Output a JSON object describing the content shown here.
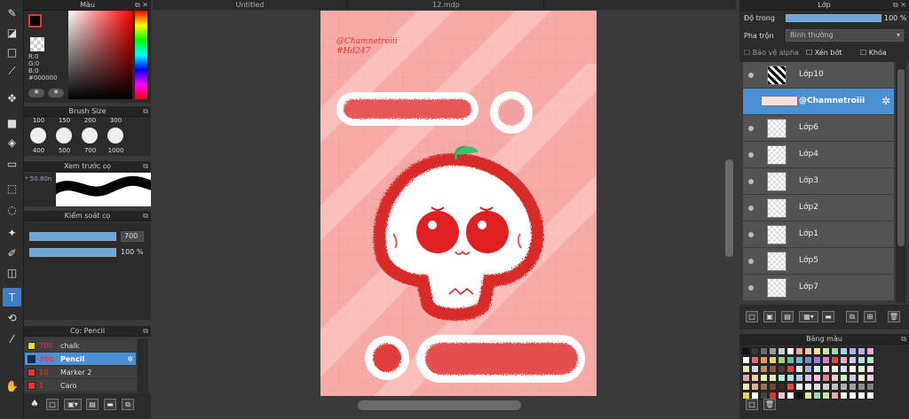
{
  "tools": [
    {
      "icon": "brush-icon"
    },
    {
      "icon": "eraser-icon"
    },
    {
      "icon": "rectangle-icon"
    },
    {
      "icon": "line-icon"
    },
    {
      "icon": "move-icon"
    },
    {
      "icon": "fill-rect-icon"
    },
    {
      "icon": "bucket-icon"
    },
    {
      "icon": "gradient-icon"
    },
    {
      "icon": "select-rect-icon"
    },
    {
      "icon": "lasso-icon"
    },
    {
      "icon": "magic-wand-icon"
    },
    {
      "icon": "select-pen-icon"
    },
    {
      "icon": "select-eraser-icon"
    },
    {
      "icon": "text-icon"
    },
    {
      "icon": "divide-icon"
    },
    {
      "icon": "dropper-icon"
    },
    {
      "icon": "hand-icon"
    }
  ],
  "color_panel": {
    "title": "Màu",
    "r": "R:0",
    "g": "G:0",
    "b": "B:0",
    "hex": "#000000"
  },
  "brush_size": {
    "title": "Brush Size",
    "top_row": [
      "100",
      "150",
      "200",
      "300"
    ],
    "sizes": [
      "400",
      "500",
      "700",
      "1000"
    ]
  },
  "brush_preview": {
    "title": "Xem trước cọ",
    "size_label": "50.80n"
  },
  "brush_control": {
    "title": "Kiểm soát cọ",
    "size_value": "700",
    "opacity_value": "100 %"
  },
  "brush_list": {
    "title": "Cọ: Pencil",
    "items": [
      {
        "size": "700",
        "name": "chalk",
        "color": "#f2d536"
      },
      {
        "size": "700",
        "name": "Pencil",
        "color": "#1f2a44",
        "selected": true
      },
      {
        "size": "10",
        "name": "Marker 2",
        "color": "#e53535"
      },
      {
        "size": "1",
        "name": "Caro",
        "color": "#e53535"
      }
    ]
  },
  "tabs": [
    "Untitled",
    "12.mdp"
  ],
  "canvas": {
    "watermark_line1": "@Chamnetroiii",
    "watermark_line2": "#Hd247"
  },
  "layer_panel": {
    "title": "Lớp",
    "opacity_label": "Độ trong",
    "opacity_value": "100 %",
    "blend_label": "Pha trộn",
    "blend_value": "Bình thường",
    "protect_alpha": "Bảo vệ alpha",
    "clipping": "Xén bớt",
    "lock": "Khóa",
    "layers": [
      {
        "name": "Lớp10"
      },
      {
        "name": "@Chamnetroiii",
        "selected": true
      },
      {
        "name": "Lớp6"
      },
      {
        "name": "Lớp4"
      },
      {
        "name": "Lớp3"
      },
      {
        "name": "Lớp2"
      },
      {
        "name": "Lớp1"
      },
      {
        "name": "Lớp5"
      },
      {
        "name": "Lớp7"
      }
    ]
  },
  "palette": {
    "title": "Bảng màu",
    "colors": [
      "#111111",
      "#3a3a3a",
      "#6b6b6b",
      "#9c9c9c",
      "#cfcfcf",
      "#ffffff",
      "#f4a6a6",
      "#f7c59f",
      "#f8e08e",
      "#c7e99b",
      "#9ed8b8",
      "#9ad6e5",
      "#a3b8ef",
      "#c2a8ef",
      "#eba7de",
      "#ffffff",
      "#e86b6b",
      "#f09a5a",
      "#f3cf4f",
      "#9fd66a",
      "#5fc49a",
      "#5abed8",
      "#6f8de0",
      "#9a78df",
      "#e47ccc",
      "#e84141",
      "#f2a8c8",
      "#c9c9f1",
      "#a8e0f2",
      "#b4efc2",
      "#f1e6a8",
      "#d8d8d8",
      "#c48a58",
      "#8c5a3a",
      "#5a3a2a",
      "#d44",
      "#e2e2e2",
      "#aad",
      "#cfe",
      "#fde",
      "#efd",
      "#ddf",
      "#ffd",
      "#dfd",
      "#fdd",
      "#e9a0a0",
      "#f4d2a0",
      "#f4ecb0",
      "#d8f0b0",
      "#b0f0d8",
      "#b0e0f0",
      "#b8c8f4",
      "#d8c0f4",
      "#f4c0e8",
      "#f08080",
      "#f8c8c8",
      "#c8f8c8",
      "#c8c8f8",
      "#f8f8c8",
      "#f8c8f8",
      "#ffe4b0",
      "#e0b080",
      "#a07050",
      "#704830",
      "#402818",
      "#ff4040",
      "#ffffff",
      "#f0f0f0",
      "#e0e0e0",
      "#d0d0d0",
      "#c0c0c0",
      "#b0b0b0",
      "#a0a0a0",
      "#909090",
      "#808080",
      "#f2d536",
      "#ffffff",
      "#444444",
      "#d33",
      "#ffc0cb",
      "#ffffff",
      "#111111",
      "#f7e08e",
      "#9ed8b8",
      "#c7e99b",
      "#f4a6a6",
      "#ffffff",
      "#ffffff",
      "#ffffff",
      "#ffffff"
    ]
  }
}
